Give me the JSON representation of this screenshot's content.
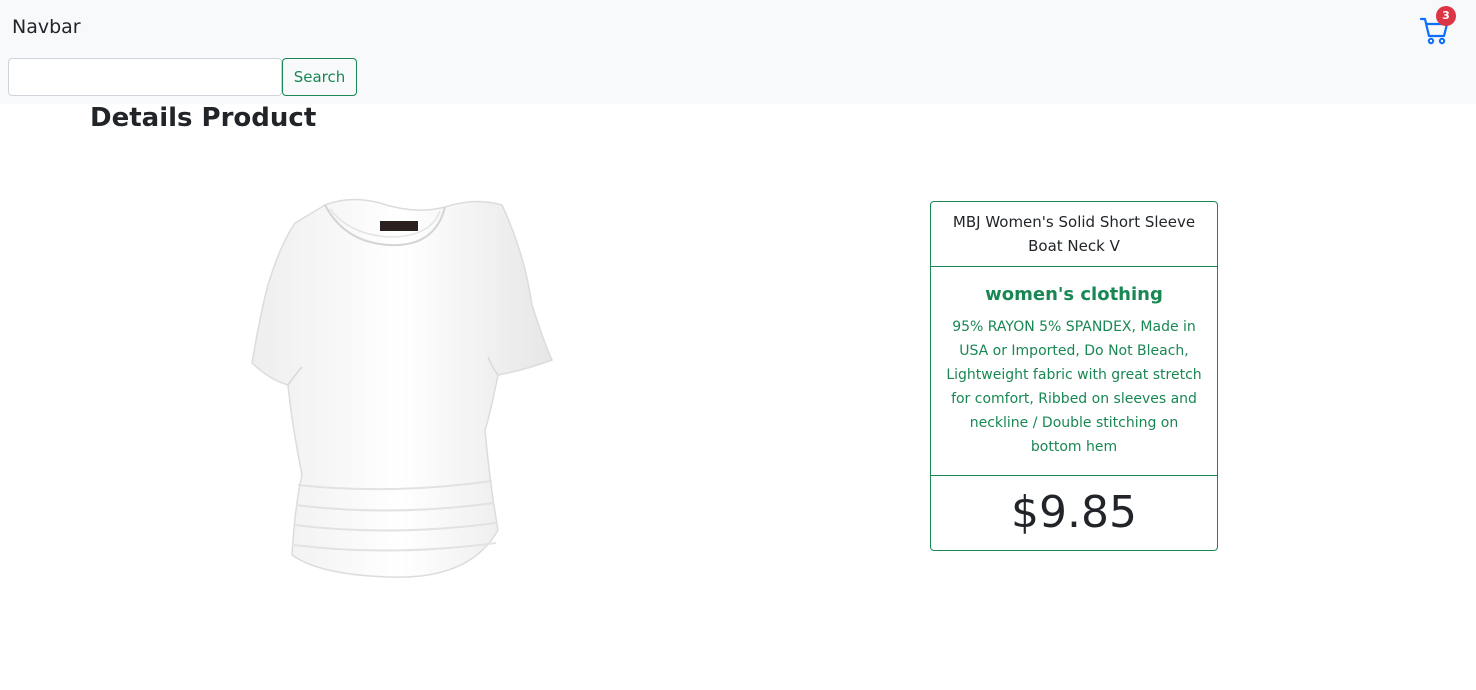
{
  "navbar": {
    "brand": "Navbar",
    "search": {
      "value": "",
      "placeholder": ""
    },
    "search_button": "Search",
    "cart": {
      "count": "3",
      "icon": "cart-icon"
    }
  },
  "page": {
    "title": "Details Product"
  },
  "product": {
    "image_icon": "white-tshirt-image",
    "title": "MBJ Women's Solid Short Sleeve Boat Neck V",
    "category": "women's clothing",
    "description": "95% RAYON 5% SPANDEX, Made in USA or Imported, Do Not Bleach, Lightweight fabric with great stretch for comfort, Ribbed on sleeves and neckline / Double stitching on bottom hem",
    "price": "$9.85"
  },
  "colors": {
    "accent": "#198754",
    "cart_icon": "#0d6efd",
    "badge": "#dc3545",
    "navbar_bg": "#f8f9fa"
  }
}
